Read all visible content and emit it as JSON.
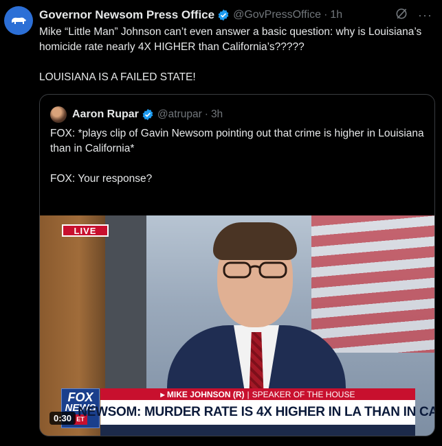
{
  "post": {
    "author_name": "Governor Newsom Press Office",
    "author_handle": "@GovPressOffice",
    "separator": "·",
    "time": "1h",
    "text_line1": "Mike “Little Man” Johnson can’t even answer a basic question: why is Louisiana’s homicide rate nearly 4X HIGHER than California’s?????",
    "text_line2": "LOUISIANA IS A FAILED STATE!",
    "avatar_icon": "bear-icon",
    "verified_icon": "verified-badge-icon",
    "actions": [
      "grok-icon",
      "more-icon"
    ],
    "more_label": "···"
  },
  "quote": {
    "author_name": "Aaron Rupar",
    "author_handle": "@atrupar",
    "separator": "·",
    "time": "3h",
    "text": "FOX: *plays clip of Gavin Newsom pointing out that crime is higher in Louisiana than in California*\n\nFOX: Your response?"
  },
  "video": {
    "live_label": "LIVE",
    "network_line1": "FOX",
    "network_line2": "NEWS",
    "network_line3": "ET",
    "chyron_name": "▸ MIKE JOHNSON (R)",
    "chyron_sep": "|",
    "chyron_title": "SPEAKER OF THE HOUSE",
    "headline": "NEWSOM: MURDER RATE IS 4X HIGHER IN LA THAN IN CA",
    "duration": "0:30"
  },
  "colors": {
    "background": "#000000",
    "text": "#e7e9ea",
    "muted": "#71767b",
    "verified": "#1d9bf0",
    "fox_red": "#c8102e",
    "fox_blue": "#1a3f8c"
  }
}
